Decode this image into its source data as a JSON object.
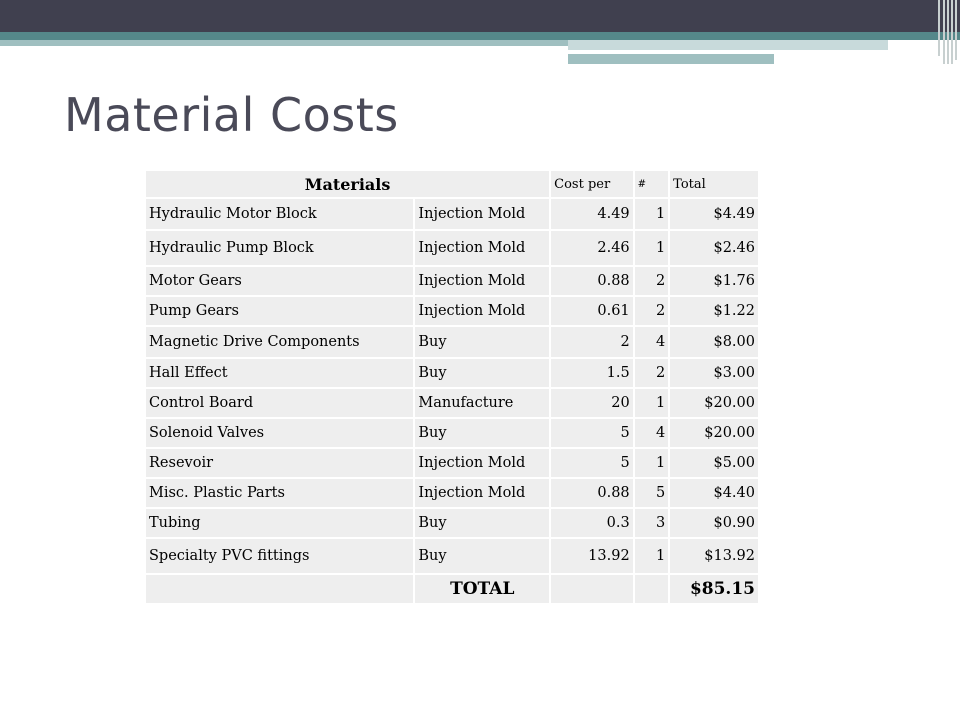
{
  "slide": {
    "title": "Material Costs"
  },
  "table": {
    "headers": {
      "materials": "Materials",
      "cost_per": "Cost per",
      "count": "#",
      "total": "Total"
    },
    "rows": [
      {
        "item": "Hydraulic Motor Block",
        "method": "Injection Mold",
        "cost": "4.49",
        "qty": "1",
        "total": "$4.49"
      },
      {
        "item": "Hydraulic Pump Block",
        "method": "Injection Mold",
        "cost": "2.46",
        "qty": "1",
        "total": "$2.46"
      },
      {
        "item": "Motor Gears",
        "method": "Injection Mold",
        "cost": "0.88",
        "qty": "2",
        "total": "$1.76"
      },
      {
        "item": "Pump Gears",
        "method": "Injection Mold",
        "cost": "0.61",
        "qty": "2",
        "total": "$1.22"
      },
      {
        "item": "Magnetic Drive Components",
        "method": "Buy",
        "cost": "2",
        "qty": "4",
        "total": "$8.00"
      },
      {
        "item": "Hall Effect",
        "method": "Buy",
        "cost": "1.5",
        "qty": "2",
        "total": "$3.00"
      },
      {
        "item": "Control Board",
        "method": "Manufacture",
        "cost": "20",
        "qty": "1",
        "total": "$20.00"
      },
      {
        "item": "Solenoid Valves",
        "method": "Buy",
        "cost": "5",
        "qty": "4",
        "total": "$20.00"
      },
      {
        "item": "Resevoir",
        "method": "Injection Mold",
        "cost": "5",
        "qty": "1",
        "total": "$5.00"
      },
      {
        "item": "Misc. Plastic Parts",
        "method": "Injection Mold",
        "cost": "0.88",
        "qty": "5",
        "total": "$4.40"
      },
      {
        "item": "Tubing",
        "method": "Buy",
        "cost": "0.3",
        "qty": "3",
        "total": "$0.90"
      },
      {
        "item": "Specialty PVC fittings",
        "method": "Buy",
        "cost": "13.92",
        "qty": "1",
        "total": "$13.92"
      }
    ],
    "footer": {
      "label": "TOTAL",
      "value": "$85.15"
    }
  }
}
